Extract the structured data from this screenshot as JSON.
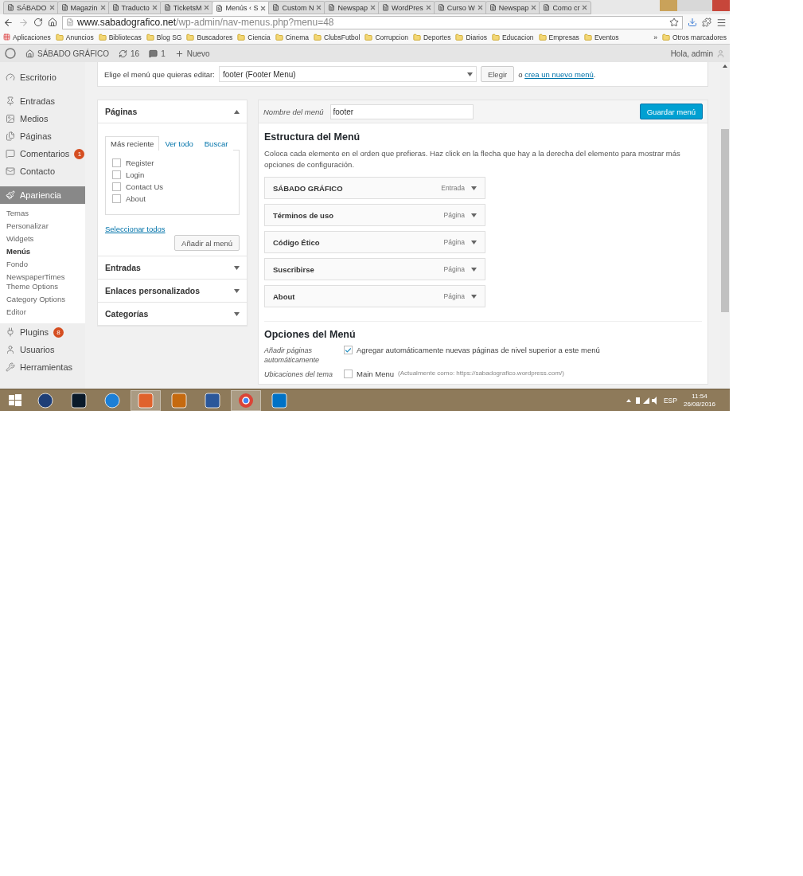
{
  "browser": {
    "tabs": [
      {
        "title": "SÁBADO",
        "selected": false
      },
      {
        "title": "Magazin",
        "selected": false
      },
      {
        "title": "Traducto",
        "selected": false
      },
      {
        "title": "TicketsM",
        "selected": false
      },
      {
        "title": "Menús ‹ S",
        "selected": true
      },
      {
        "title": "Custom N",
        "selected": false
      },
      {
        "title": "Newspap",
        "selected": false
      },
      {
        "title": "WordPres",
        "selected": false
      },
      {
        "title": "Curso W",
        "selected": false
      },
      {
        "title": "Newspap",
        "selected": false
      },
      {
        "title": "Como cr",
        "selected": false
      }
    ],
    "address": {
      "domain": "www.sabadografico.net",
      "path": "/wp-admin/nav-menus.php?menu=48"
    },
    "apps_label": "Aplicaciones",
    "bookmarks": [
      "Anuncios",
      "Bibliotecas",
      "Blog SG",
      "Buscadores",
      "Ciencia",
      "Cinema",
      "ClubsFutbol",
      "Corrupcion",
      "Deportes",
      "Diarios",
      "Educacion",
      "Empresas",
      "Eventos"
    ],
    "bookmarks_more": "»",
    "other_bookmarks": "Otros marcadores"
  },
  "admin_bar": {
    "site": "SÁBADO GRÁFICO",
    "updates": "16",
    "comments": "1",
    "new": "Nuevo",
    "greeting": "Hola, admin"
  },
  "sidebar": {
    "items": [
      {
        "label": "Escritorio",
        "selected": false
      },
      {
        "label": "Entradas",
        "selected": false
      },
      {
        "label": "Medios",
        "selected": false
      },
      {
        "label": "Páginas",
        "selected": false
      },
      {
        "label": "Comentarios",
        "selected": false,
        "badge": "1"
      },
      {
        "label": "Contacto",
        "selected": false
      },
      {
        "label": "Apariencia",
        "selected": true,
        "children": [
          {
            "label": "Temas",
            "selected": false
          },
          {
            "label": "Personalizar",
            "selected": false
          },
          {
            "label": "Widgets",
            "selected": false
          },
          {
            "label": "Menús",
            "selected": true
          },
          {
            "label": "Fondo",
            "selected": false
          },
          {
            "label": "NewspaperTimes Theme Options",
            "selected": false
          },
          {
            "label": "Category Options",
            "selected": false
          },
          {
            "label": "Editor",
            "selected": false
          }
        ]
      },
      {
        "label": "Plugins",
        "selected": false,
        "badge": "8"
      },
      {
        "label": "Usuarios",
        "selected": false
      },
      {
        "label": "Herramientas",
        "selected": false
      }
    ]
  },
  "menu_select": {
    "label": "Elige el menú que quieras editar:",
    "value": "footer (Footer Menu)",
    "button": "Elegir",
    "or": "o",
    "create_link": "crea un nuevo menú",
    "after": "."
  },
  "pages_panel": {
    "title": "Páginas",
    "expanded": true,
    "tabs": [
      {
        "label": "Más reciente",
        "selected": true
      },
      {
        "label": "Ver todo",
        "selected": false
      },
      {
        "label": "Buscar",
        "selected": false
      }
    ],
    "items": [
      {
        "label": "Register",
        "checked": false
      },
      {
        "label": "Login",
        "checked": false
      },
      {
        "label": "Contact Us",
        "checked": false
      },
      {
        "label": "About",
        "checked": false
      }
    ],
    "select_all": "Seleccionar todos",
    "add_button": "Añadir al menú"
  },
  "other_panels": [
    {
      "title": "Entradas",
      "expanded": false
    },
    {
      "title": "Enlaces personalizados",
      "expanded": false
    },
    {
      "title": "Categorías",
      "expanded": false
    }
  ],
  "menu_editor": {
    "name_label": "Nombre del menú",
    "name_value": "footer",
    "save_button": "Guardar menú",
    "structure_title": "Estructura del Menú",
    "structure_help": "Coloca cada elemento en el orden que prefieras. Haz click en la flecha que hay a la derecha del elemento para mostrar más opciones de configuración.",
    "items": [
      {
        "title": "SÁBADO GRÁFICO",
        "type": "Entrada"
      },
      {
        "title": "Términos de uso",
        "type": "Página"
      },
      {
        "title": "Código Ético",
        "type": "Página"
      },
      {
        "title": "Suscribirse",
        "type": "Página"
      },
      {
        "title": "About",
        "type": "Página"
      }
    ],
    "options_title": "Opciones del Menú",
    "settings": [
      {
        "label": "Añadir páginas automáticamente",
        "option": "Agregar automáticamente nuevas páginas de nivel superior a este menú",
        "checked": true
      },
      {
        "label": "Ubicaciones del tema",
        "option": "Main Menu",
        "note": "(Actualmente como: https://sabadografico.wordpress.com/)",
        "checked": false
      }
    ]
  },
  "taskbar": {
    "language": "ESP",
    "time": "11:54",
    "date": "26/08/2016"
  }
}
